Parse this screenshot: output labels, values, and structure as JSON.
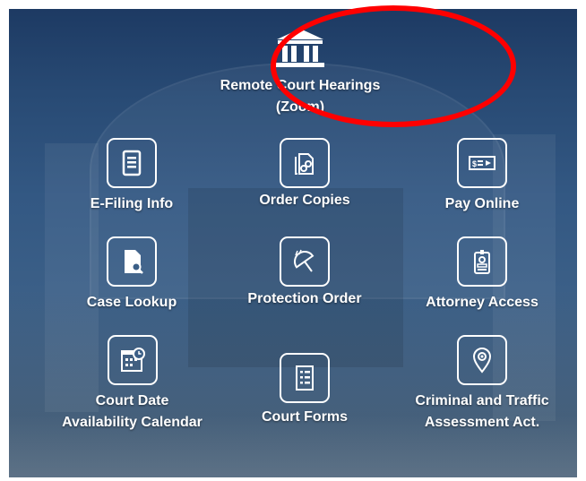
{
  "hero": {
    "line1": "Remote Court Hearings",
    "line2": "(Zoom)",
    "icon": "courthouse-icon"
  },
  "tiles": [
    {
      "label": "E-Filing Info",
      "icon": "document-icon"
    },
    {
      "label": "Order Copies",
      "icon": "copies-link-icon"
    },
    {
      "label": "Pay Online",
      "icon": "check-payment-icon"
    },
    {
      "label": "Case Lookup",
      "icon": "file-search-icon"
    },
    {
      "label": "Protection Order",
      "icon": "umbrella-icon"
    },
    {
      "label": "Attorney Access",
      "icon": "id-badge-icon"
    },
    {
      "label": "Court Date Availability Calendar",
      "line1": "Court Date",
      "line2": "Availability Calendar",
      "icon": "calendar-clock-icon"
    },
    {
      "label": "Court Forms",
      "icon": "form-icon"
    },
    {
      "label": "Criminal and Traffic Assessment Act.",
      "line1": "Criminal and Traffic",
      "line2": "Assessment Act.",
      "icon": "location-pin-icon"
    }
  ],
  "colors": {
    "annotation": "#ff0000",
    "text": "#ffffff"
  }
}
